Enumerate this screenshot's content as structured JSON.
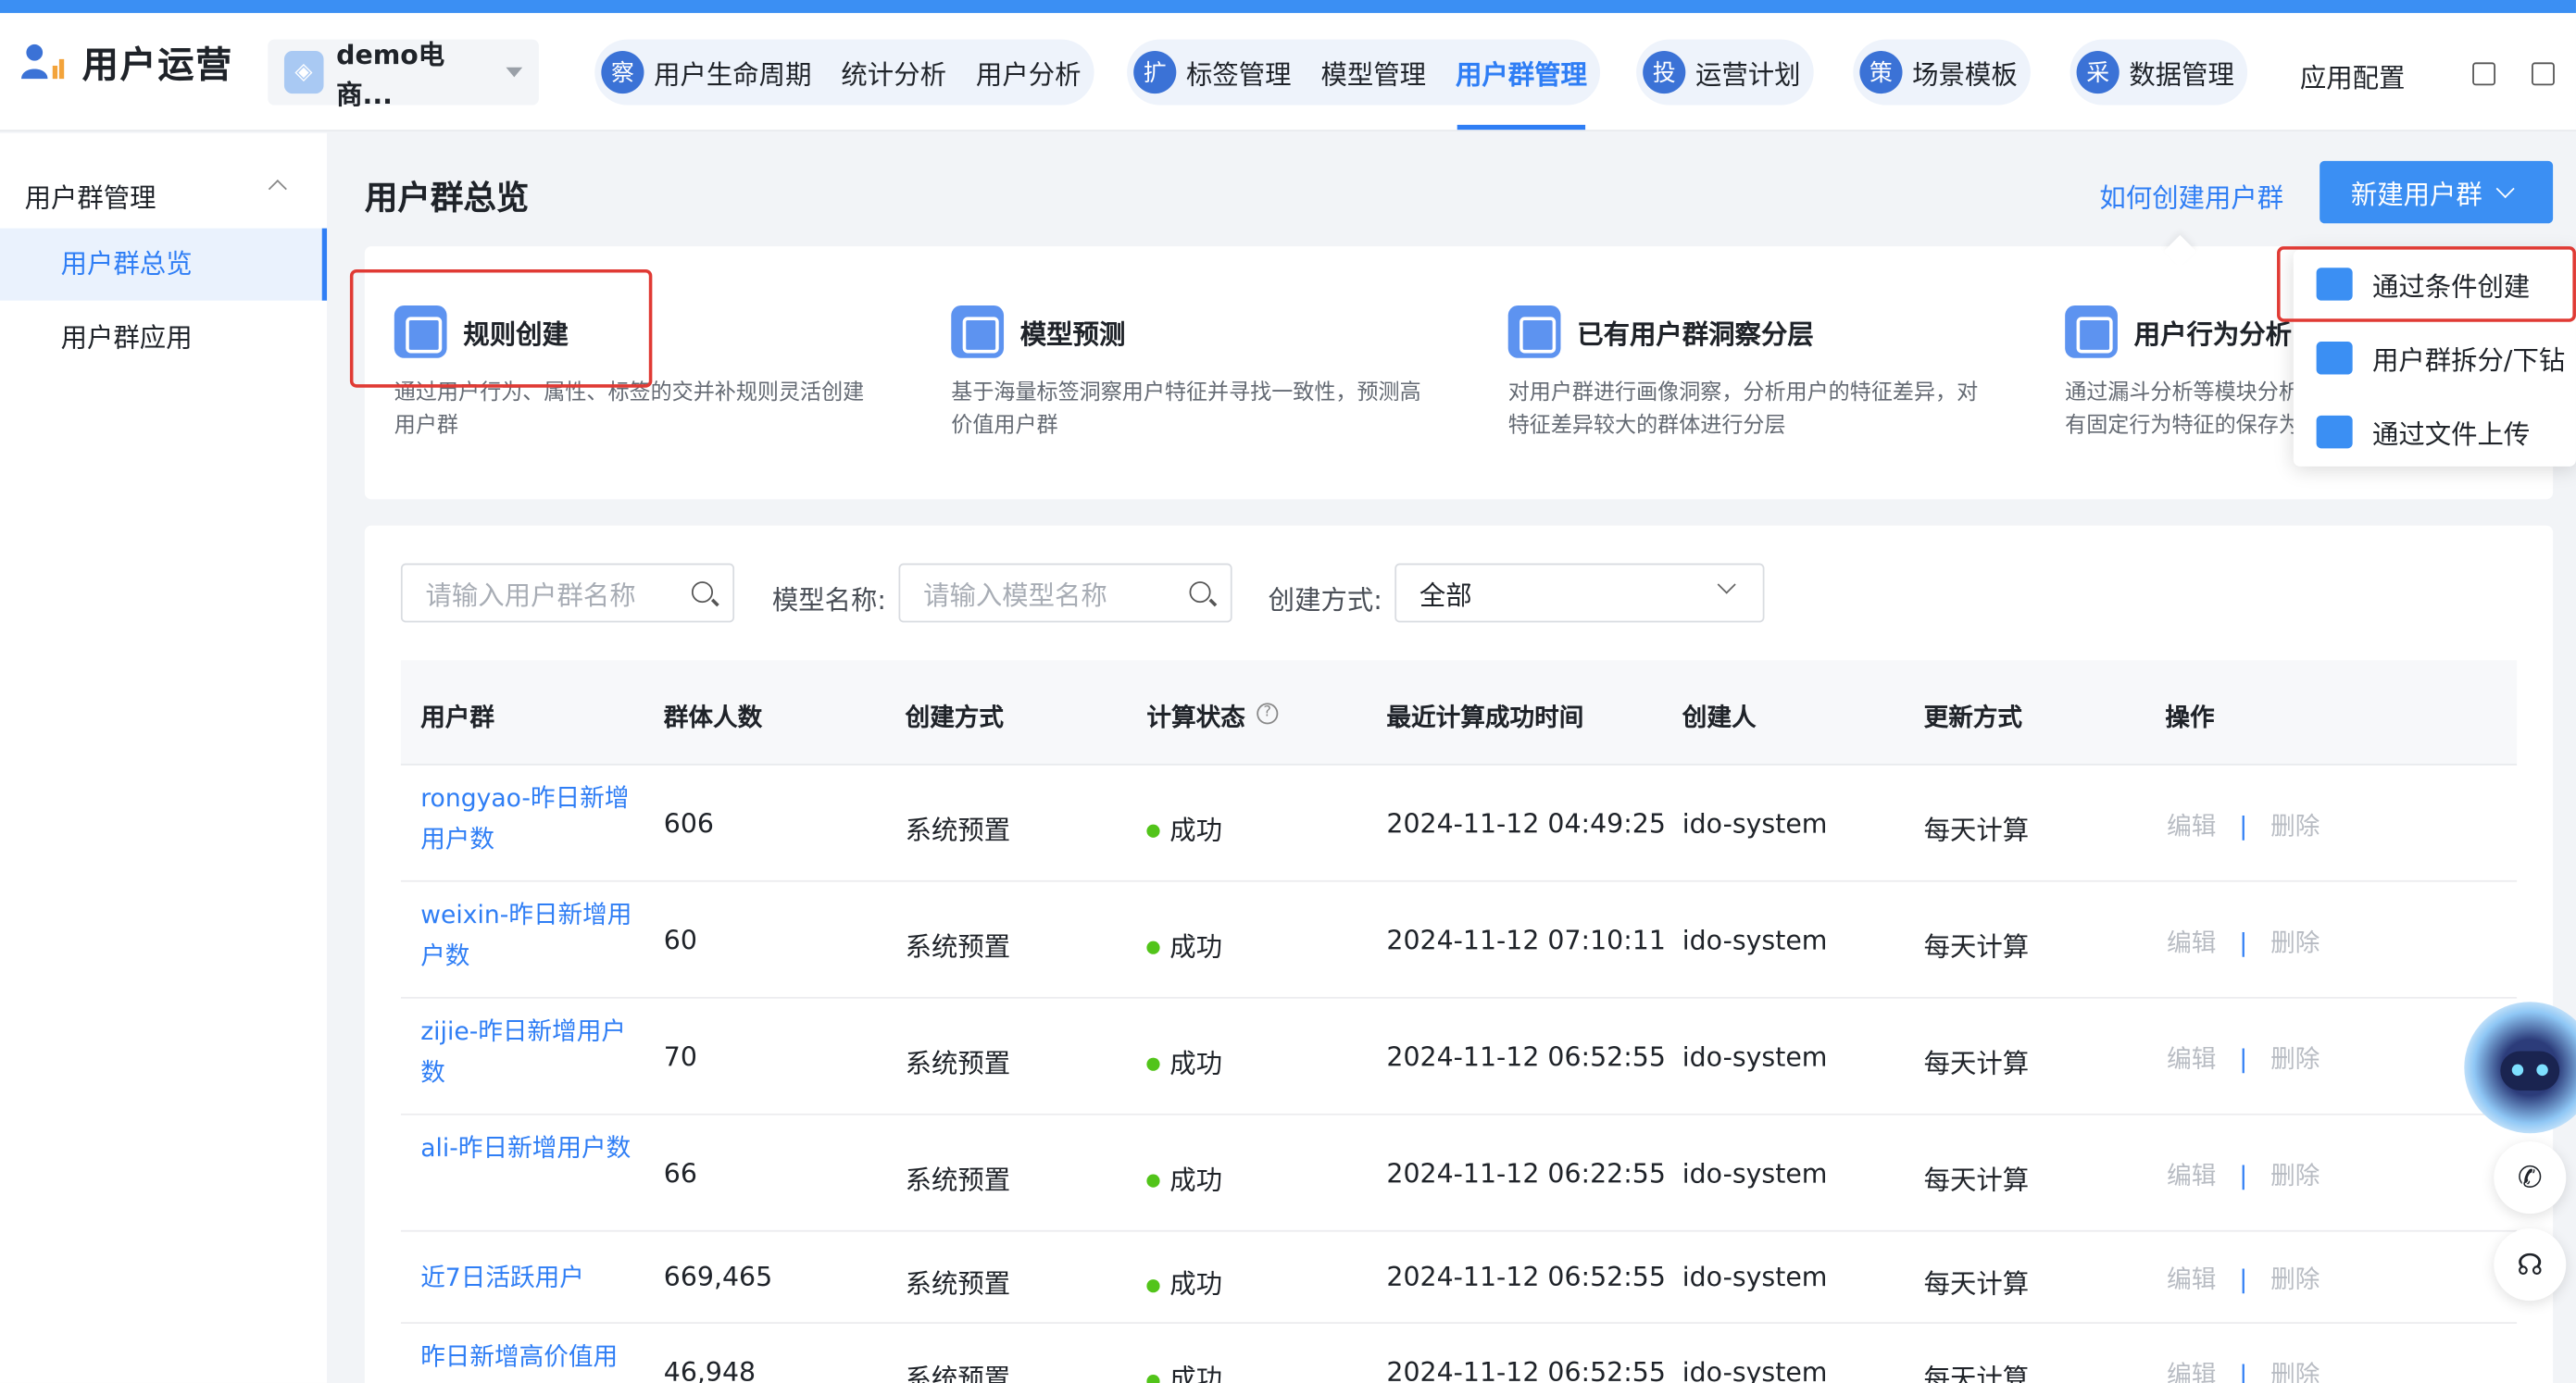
{
  "app": {
    "title": "用户运营",
    "project": "demo电商..."
  },
  "nav": {
    "group1": {
      "badge": "察",
      "items": [
        "用户生命周期",
        "统计分析",
        "用户分析"
      ]
    },
    "group2": {
      "badge": "扩",
      "items": [
        "标签管理",
        "模型管理",
        "用户群管理"
      ]
    },
    "group3": {
      "badge": "投",
      "items": [
        "运营计划"
      ]
    },
    "group4": {
      "badge": "策",
      "items": [
        "场景模板"
      ]
    },
    "group5": {
      "badge": "采",
      "items": [
        "数据管理"
      ]
    },
    "config": "应用配置",
    "active": "用户群管理"
  },
  "sidebar": {
    "header": "用户群管理",
    "items": [
      {
        "label": "用户群总览"
      },
      {
        "label": "用户群应用"
      }
    ]
  },
  "page": {
    "title": "用户群总览",
    "how_to": "如何创建用户群",
    "new_button": "新建用户群"
  },
  "cards": [
    {
      "title": "规则创建",
      "desc": "通过用户行为、属性、标签的交并补规则灵活创建用户群"
    },
    {
      "title": "模型预测",
      "desc": "基于海量标签洞察用户特征并寻找一致性，预测高价值用户群"
    },
    {
      "title": "已有用户群洞察分层",
      "desc": "对用户群进行画像洞察，分析用户的特征差异，对特征差异较大的群体进行分层"
    },
    {
      "title": "用户行为分析",
      "desc": "通过漏斗分析等模块分析有固定行为特征的保存为"
    }
  ],
  "dropdown": {
    "items": [
      "通过条件创建",
      "用户群拆分/下钻",
      "通过文件上传"
    ]
  },
  "filters": {
    "group_placeholder": "请输入用户群名称",
    "model_label": "模型名称:",
    "model_placeholder": "请输入模型名称",
    "method_label": "创建方式:",
    "method_value": "全部"
  },
  "table": {
    "columns": [
      "用户群",
      "群体人数",
      "创建方式",
      "计算状态",
      "最近计算成功时间",
      "创建人",
      "更新方式",
      "操作"
    ],
    "ops": {
      "edit": "编辑",
      "sep": "|",
      "delete": "删除"
    },
    "rows": [
      {
        "name": "rongyao-昨日新增用户数",
        "count": "606",
        "method": "系统预置",
        "status": "成功",
        "time": "2024-11-12 04:49:25",
        "creator": "ido-system",
        "update": "每天计算"
      },
      {
        "name": "weixin-昨日新增用户数",
        "count": "60",
        "method": "系统预置",
        "status": "成功",
        "time": "2024-11-12 07:10:11",
        "creator": "ido-system",
        "update": "每天计算"
      },
      {
        "name": "zijie-昨日新增用户数",
        "count": "70",
        "method": "系统预置",
        "status": "成功",
        "time": "2024-11-12 06:52:55",
        "creator": "ido-system",
        "update": "每天计算"
      },
      {
        "name": "ali-昨日新增用户数",
        "count": "66",
        "method": "系统预置",
        "status": "成功",
        "time": "2024-11-12 06:22:55",
        "creator": "ido-system",
        "update": "每天计算"
      },
      {
        "name": "近7日活跃用户",
        "count": "669,465",
        "method": "系统预置",
        "status": "成功",
        "time": "2024-11-12 06:52:55",
        "creator": "ido-system",
        "update": "每天计算"
      },
      {
        "name": "昨日新增高价值用",
        "count": "46,948",
        "method": "系统预置",
        "status": "成功",
        "time": "2024-11-12 06:52:55",
        "creator": "ido-system",
        "update": "每天计算"
      }
    ]
  }
}
